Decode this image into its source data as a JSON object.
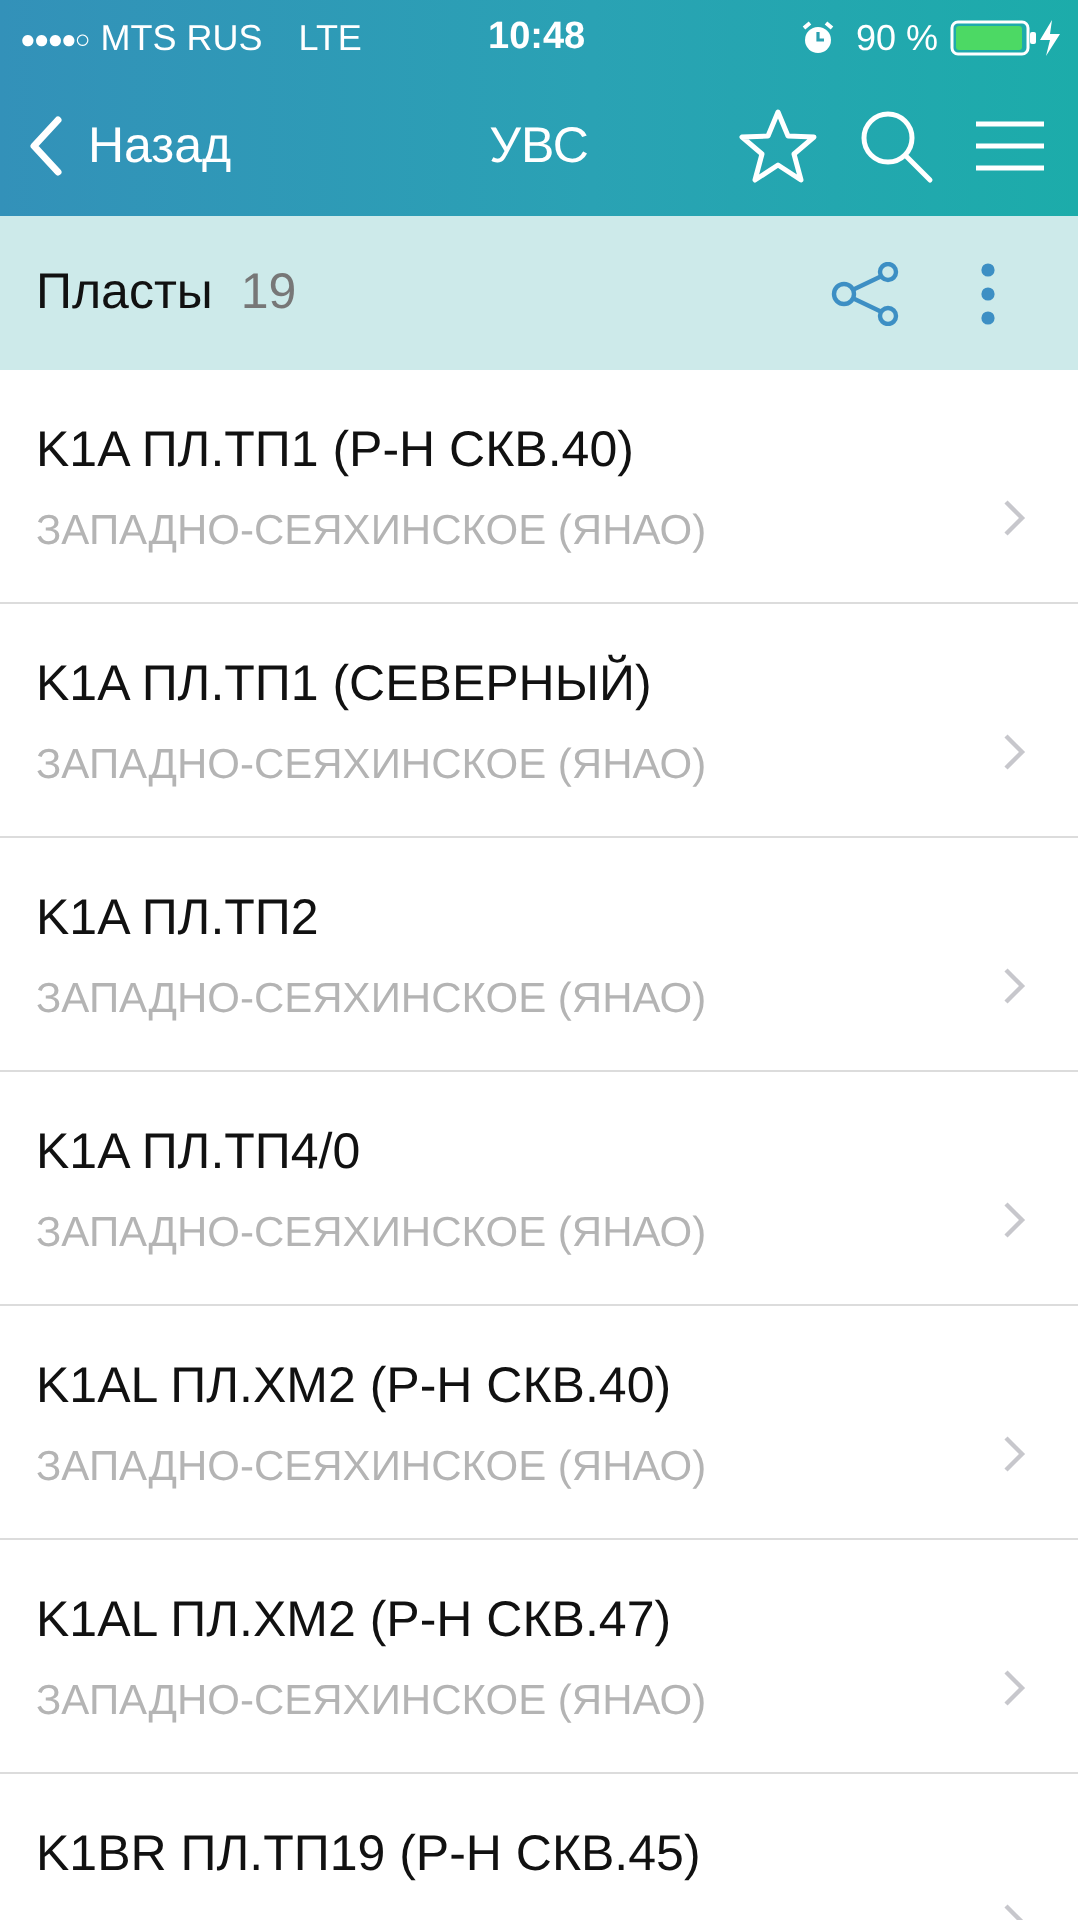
{
  "status_bar": {
    "signal_dots": "●●●●○",
    "carrier": "MTS RUS",
    "network": "LTE",
    "time": "10:48",
    "battery": "90 %"
  },
  "nav_bar": {
    "back": "Назад",
    "title": "УВС"
  },
  "section": {
    "title": "Пласты",
    "count": "19"
  },
  "rows": [
    {
      "title": "K1A ПЛ.ТП1 (Р-Н СКВ.40)",
      "subtitle": "ЗАПАДНО-СЕЯХИНСКОЕ (ЯНАО)"
    },
    {
      "title": "K1A ПЛ.ТП1 (СЕВЕРНЫЙ)",
      "subtitle": "ЗАПАДНО-СЕЯХИНСКОЕ (ЯНАО)"
    },
    {
      "title": "K1A ПЛ.ТП2",
      "subtitle": "ЗАПАДНО-СЕЯХИНСКОЕ (ЯНАО)"
    },
    {
      "title": "K1A ПЛ.ТП4/0",
      "subtitle": "ЗАПАДНО-СЕЯХИНСКОЕ (ЯНАО)"
    },
    {
      "title": "K1AL ПЛ.ХМ2 (Р-Н СКВ.40)",
      "subtitle": "ЗАПАДНО-СЕЯХИНСКОЕ (ЯНАО)"
    },
    {
      "title": "K1AL ПЛ.ХМ2 (Р-Н СКВ.47)",
      "subtitle": "ЗАПАДНО-СЕЯХИНСКОЕ (ЯНАО)"
    },
    {
      "title": "K1BR ПЛ.ТП19 (Р-Н СКВ.45)"
    }
  ]
}
